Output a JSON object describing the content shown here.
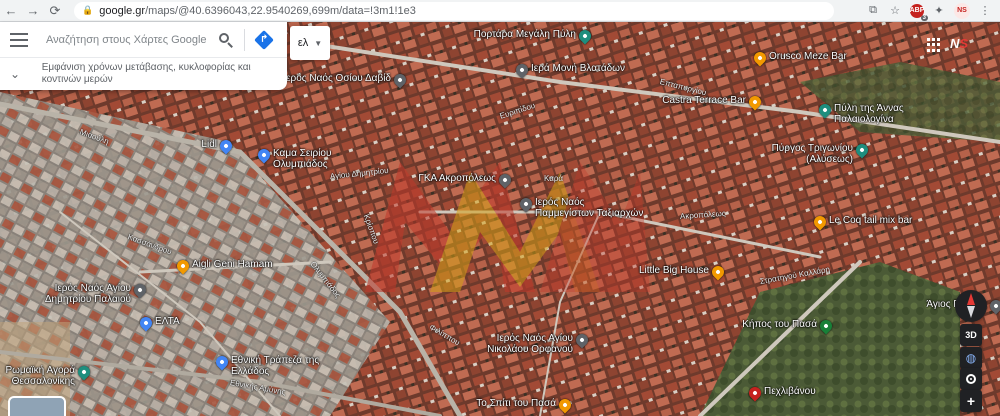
{
  "browser": {
    "back_icon": "arrow-left-icon",
    "forward_icon": "arrow-right-icon",
    "reload_icon": "reload-icon",
    "address_host": "google.gr",
    "address_path": "/maps/@40.6396043,22.9540269,699m/data=!3m1!1e3",
    "ext_badge_label": "ABP",
    "ext_badge_count": "3",
    "profile_initials": "NS"
  },
  "search": {
    "placeholder": "Αναζήτηση στους Χάρτες Google",
    "transit_text": "Εμφάνιση χρόνων μετάβασης, κυκλοφορίας και κοντινών μερών",
    "language": "ελ"
  },
  "controls": {
    "button_3d": "3D",
    "zoom_in": "+"
  },
  "account_mark": {
    "prefix": "N",
    "accent": "S"
  },
  "pois": [
    {
      "name": "Πορτάρα Μεγάλη Πύλη",
      "icon": "landmark-icon",
      "color": "#1e8e7e"
    },
    {
      "name": "Ιερά Μονή Βλατάδων",
      "icon": "church-icon",
      "color": "#5f6368"
    },
    {
      "name": "Orusco Meze Bar",
      "icon": "bar-icon",
      "color": "#f29900"
    },
    {
      "name": "Castra Terrace Bar",
      "icon": "bar-icon",
      "color": "#f29900"
    },
    {
      "name": "Πύλη της Άννας Παλαιολογίνα",
      "icon": "landmark-icon",
      "color": "#1e8e7e"
    },
    {
      "name": "Ιερός Ναός Οσίου Δαβίδ",
      "icon": "church-icon",
      "color": "#5f6368"
    },
    {
      "name": "Lidl",
      "icon": "shop-icon",
      "color": "#4285f4"
    },
    {
      "name": "Καμα Σειρίου Ολυμπιάδος",
      "icon": "school-icon",
      "color": "#4285f4"
    },
    {
      "name": "Πύργος Τριγωνίου (Αλύσεως)",
      "icon": "landmark-icon",
      "color": "#1e8e7e"
    },
    {
      "name": "ΓΚΑ Ακροπόλεως",
      "icon": "church-icon",
      "color": "#5f6368"
    },
    {
      "name": "Ιερός Ναός Παμμεγίστων Ταξιαρχών",
      "icon": "church-icon",
      "color": "#5f6368"
    },
    {
      "name": "Le Coq tail mix bar",
      "icon": "bar-icon",
      "color": "#f29900"
    },
    {
      "name": "Aigli Geni Hamam",
      "icon": "bar-icon",
      "color": "#f29900"
    },
    {
      "name": "Little Big House",
      "icon": "bar-icon",
      "color": "#f29900"
    },
    {
      "name": "Ιερός Ναός Αγίου Δημητρίου Παλαιού",
      "icon": "church-icon",
      "color": "#5f6368"
    },
    {
      "name": "ΕΛΤΑ",
      "icon": "post-icon",
      "color": "#4285f4"
    },
    {
      "name": "Κήπος του Πασά",
      "icon": "park-icon",
      "color": "#188038"
    },
    {
      "name": "Ιερός Ναός Αγίου Νικολάου Ορφανού",
      "icon": "church-icon",
      "color": "#5f6368"
    },
    {
      "name": "Εθνική Τράπεζα της Ελλάδος",
      "icon": "bank-icon",
      "color": "#4285f4"
    },
    {
      "name": "Ρωμαϊκή Αγορά Θεσσαλονίκης",
      "icon": "landmark-icon",
      "color": "#1e8e7e"
    },
    {
      "name": "Το Σπίτι του Πασά",
      "icon": "bar-icon",
      "color": "#f29900"
    },
    {
      "name": "Πεχλιβάνου",
      "icon": "hospital-icon",
      "color": "#c5221f"
    },
    {
      "name": "Άγιος Παύλος",
      "icon": "church-icon",
      "color": "#5f6368"
    }
  ],
  "streets": [
    "Μιαούλη",
    "Ολυμπιάδος",
    "Ακροπόλεως",
    "Επταπυργίου",
    "Ευριπίδου",
    "Αγίου Δημητρίου",
    "Κασσάνδρου",
    "Στρατηγού Καλλάρη",
    "Κρίσπου",
    "Καρά",
    "Εθνικής Αμύνης",
    "Φιλίππου"
  ],
  "colors": {
    "brand_blue": "#1a73e8",
    "watermark_red": "#c0392b",
    "watermark_gold": "#d4a017"
  }
}
